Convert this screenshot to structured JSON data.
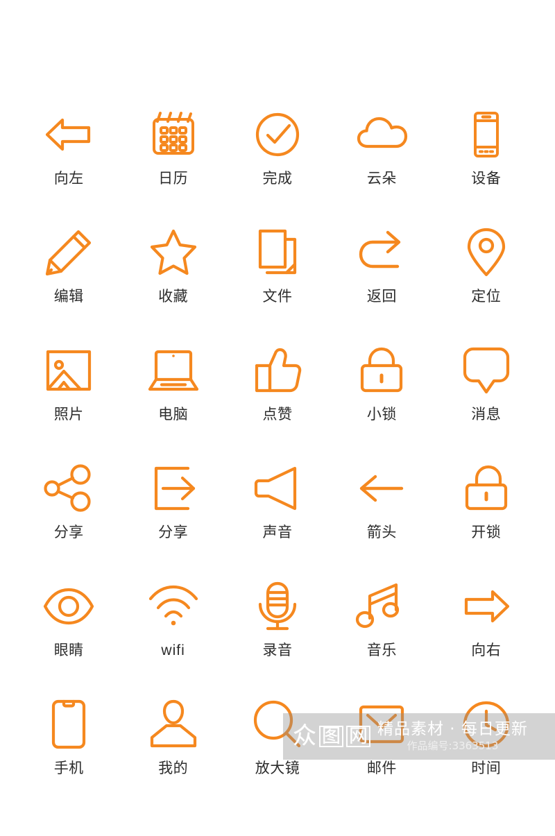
{
  "page": {
    "background_color": "#ffffff",
    "icon_color": "#F5881F",
    "label_color": "#2c2c2c",
    "columns": 5,
    "rows": 6
  },
  "icons": [
    {
      "id": "arrow-left",
      "label": "向左",
      "icon_name": "arrow-left-icon"
    },
    {
      "id": "calendar",
      "label": "日历",
      "icon_name": "calendar-icon"
    },
    {
      "id": "done",
      "label": "完成",
      "icon_name": "check-circle-icon"
    },
    {
      "id": "cloud",
      "label": "云朵",
      "icon_name": "cloud-icon"
    },
    {
      "id": "device",
      "label": "设备",
      "icon_name": "device-icon"
    },
    {
      "id": "edit",
      "label": "编辑",
      "icon_name": "pencil-icon"
    },
    {
      "id": "favorite",
      "label": "收藏",
      "icon_name": "star-icon"
    },
    {
      "id": "file",
      "label": "文件",
      "icon_name": "file-icon"
    },
    {
      "id": "return",
      "label": "返回",
      "icon_name": "redo-arrow-icon"
    },
    {
      "id": "location",
      "label": "定位",
      "icon_name": "map-pin-icon"
    },
    {
      "id": "photo",
      "label": "照片",
      "icon_name": "photo-icon"
    },
    {
      "id": "computer",
      "label": "电脑",
      "icon_name": "laptop-icon"
    },
    {
      "id": "like",
      "label": "点赞",
      "icon_name": "thumbs-up-icon"
    },
    {
      "id": "lock",
      "label": "小锁",
      "icon_name": "lock-closed-icon"
    },
    {
      "id": "message",
      "label": "消息",
      "icon_name": "speech-bubble-icon"
    },
    {
      "id": "share-nodes",
      "label": "分享",
      "icon_name": "share-nodes-icon"
    },
    {
      "id": "share-export",
      "label": "分享",
      "icon_name": "export-arrow-icon"
    },
    {
      "id": "sound",
      "label": "声音",
      "icon_name": "speaker-icon"
    },
    {
      "id": "arrow",
      "label": "箭头",
      "icon_name": "arrow-left-line-icon"
    },
    {
      "id": "unlock",
      "label": "开锁",
      "icon_name": "lock-open-icon"
    },
    {
      "id": "eye",
      "label": "眼睛",
      "icon_name": "eye-icon"
    },
    {
      "id": "wifi",
      "label": "wifi",
      "icon_name": "wifi-icon"
    },
    {
      "id": "record",
      "label": "录音",
      "icon_name": "microphone-icon"
    },
    {
      "id": "music",
      "label": "音乐",
      "icon_name": "music-note-icon"
    },
    {
      "id": "arrow-right",
      "label": "向右",
      "icon_name": "arrow-right-icon"
    },
    {
      "id": "phone",
      "label": "手机",
      "icon_name": "smartphone-icon"
    },
    {
      "id": "profile",
      "label": "我的",
      "icon_name": "user-icon"
    },
    {
      "id": "magnifier",
      "label": "放大镜",
      "icon_name": "magnifier-icon"
    },
    {
      "id": "mail",
      "label": "邮件",
      "icon_name": "envelope-icon"
    },
    {
      "id": "time",
      "label": "时间",
      "icon_name": "clock-icon"
    }
  ],
  "watermark": {
    "logo_chars": [
      "众",
      "图",
      "网"
    ],
    "tagline": "精品素材 · 每日更新",
    "code": "作品编号:3363513"
  }
}
